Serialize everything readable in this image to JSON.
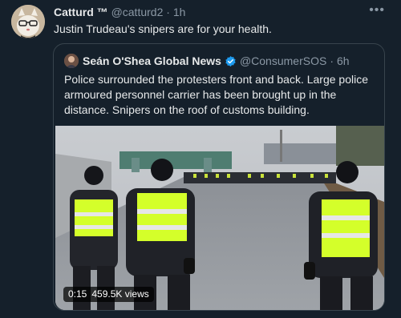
{
  "tweet": {
    "author_name": "Catturd ™",
    "handle": "@catturd2",
    "separator": "·",
    "time": "1h",
    "text": "Justin Trudeau's snipers are for your health."
  },
  "quote": {
    "author_name": "Seán O'Shea Global News",
    "handle": "@ConsumerSOS",
    "separator": "·",
    "time": "6h",
    "text": "Police surrounded the protesters front and back. Large police armoured personnel carrier has been brought up in the distance. Snipers on the roof of customs building."
  },
  "media": {
    "duration": "0:15",
    "views": "459.5K views"
  },
  "icons": {
    "more": "more-icon",
    "verified": "verified-badge-icon"
  },
  "colors": {
    "background": "#15202b",
    "verified": "#1d9bf0",
    "vest": "#d4ff2a"
  }
}
